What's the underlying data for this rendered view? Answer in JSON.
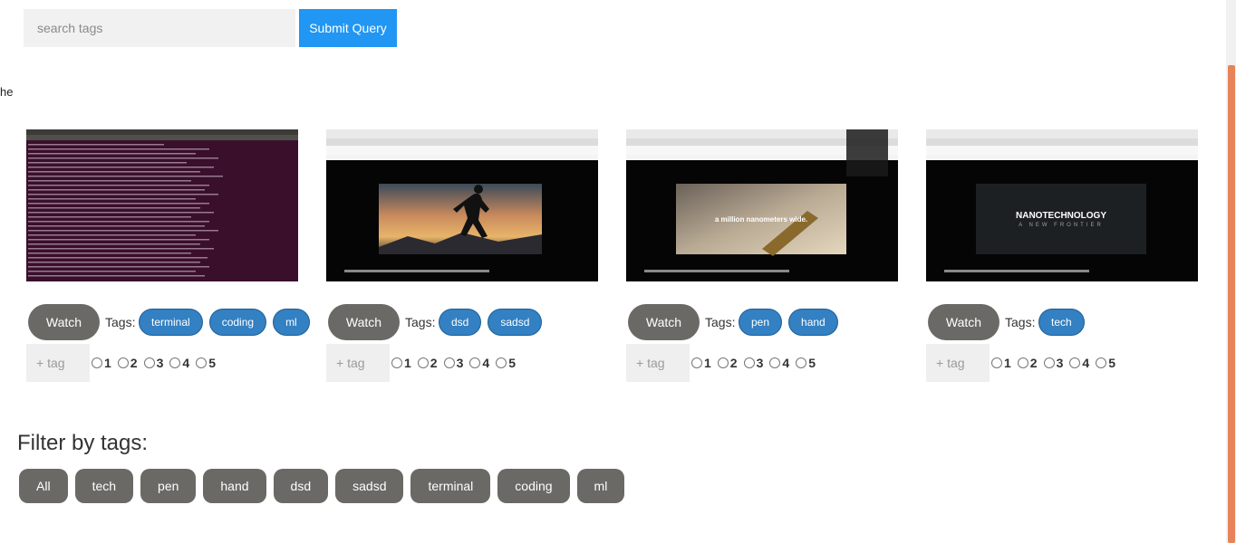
{
  "search": {
    "placeholder": "search tags",
    "submit_label": "Submit Query"
  },
  "stray_text": "he",
  "tags_label": "Tags:",
  "watch_label": "Watch",
  "tag_input_placeholder": "+ tag",
  "ratings": [
    "1",
    "2",
    "3",
    "4",
    "5"
  ],
  "cards": [
    {
      "thumbnail": "terminal-screenshot",
      "tags": [
        "terminal",
        "coding",
        "ml"
      ]
    },
    {
      "thumbnail": "runner-video-screenshot",
      "tags": [
        "dsd",
        "sadsd"
      ]
    },
    {
      "thumbnail": "pen-video-screenshot",
      "overlay_text": "a million nanometers wide.",
      "tags": [
        "pen",
        "hand"
      ]
    },
    {
      "thumbnail": "nanotech-video-screenshot",
      "overlay_title": "NANOTECHNOLOGY",
      "overlay_subtitle": "A NEW FRONTIER",
      "tags": [
        "tech"
      ]
    }
  ],
  "filter": {
    "title": "Filter by tags:",
    "buttons": [
      "All",
      "tech",
      "pen",
      "hand",
      "dsd",
      "sadsd",
      "terminal",
      "coding",
      "ml"
    ]
  },
  "colors": {
    "accent": "#2196f3",
    "tag_pill": "#3380c2",
    "button_gray": "#6b6966",
    "scroll_thumb": "#e8825a"
  }
}
